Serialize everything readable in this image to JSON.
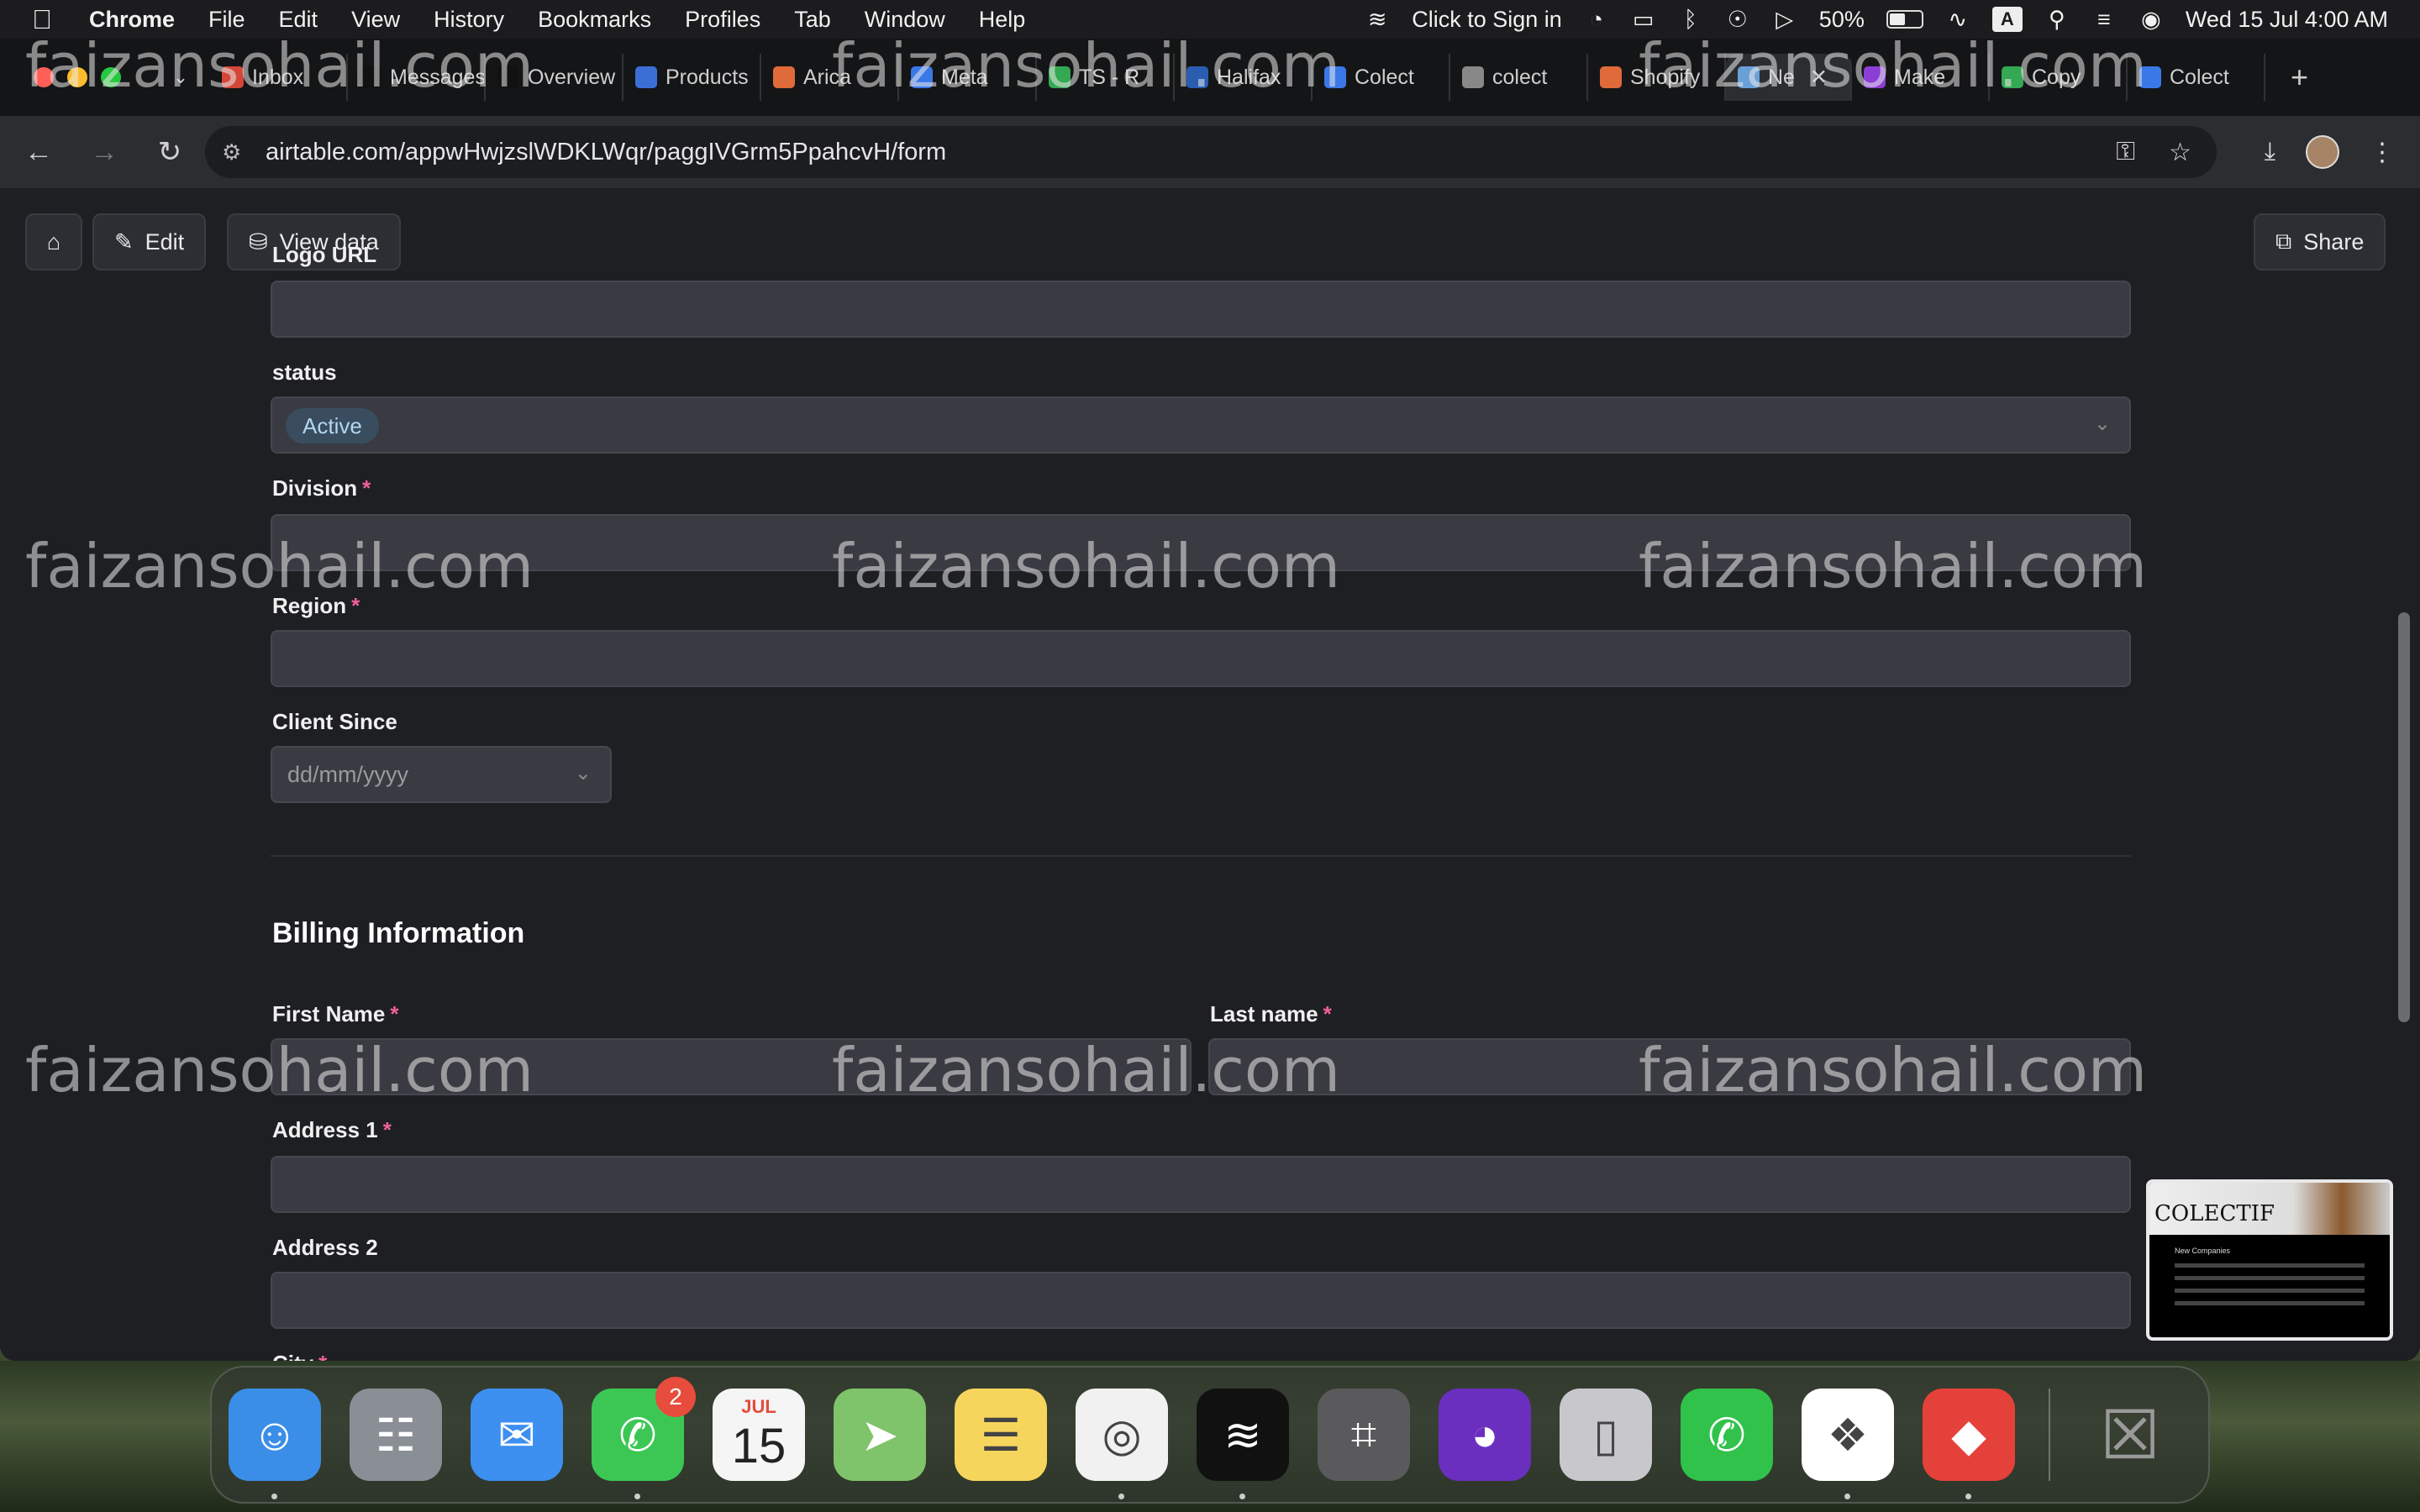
{
  "menubar": {
    "apple": "",
    "items": [
      "Chrome",
      "File",
      "Edit",
      "View",
      "History",
      "Bookmarks",
      "Profiles",
      "Tab",
      "Window",
      "Help"
    ],
    "sign_in": "Click to Sign in",
    "battery": "50%",
    "battery_level": 0.5,
    "input_source": "A",
    "datetime": "Wed 15 Jul  4:00 AM"
  },
  "tabs": [
    {
      "label": "Inbox",
      "color": "#d44638"
    },
    {
      "label": "Messages",
      "color": "#111111"
    },
    {
      "label": "Overview",
      "color": "#111111"
    },
    {
      "label": "Products",
      "color": "#3b6fd6"
    },
    {
      "label": "Arica",
      "color": "#e06a3a"
    },
    {
      "label": "Meta",
      "color": "#3b78e7"
    },
    {
      "label": "TS - R",
      "color": "#34a853"
    },
    {
      "label": "Halifax",
      "color": "#2a5db0"
    },
    {
      "label": "Colect",
      "color": "#3b78e7"
    },
    {
      "label": "colect",
      "color": "#888888"
    },
    {
      "label": "Shopify",
      "color": "#e06a3a"
    },
    {
      "label": "Ne",
      "color": "#6aa0d8",
      "active": true
    },
    {
      "label": "Make",
      "color": "#8b3dd6"
    },
    {
      "label": "Copy",
      "color": "#34a853"
    },
    {
      "label": "Colect",
      "color": "#3b78e7"
    }
  ],
  "address": {
    "url": "airtable.com/appwHwjzslWDKLWqr/paggIVGrm5PpahcvH/form"
  },
  "toolbar": {
    "home_label": "",
    "edit_label": "Edit",
    "view_data_label": "View data",
    "share_label": "Share"
  },
  "form": {
    "logo_url_label": "Logo URL",
    "status_label": "status",
    "status_value": "Active",
    "division_label": "Division",
    "region_label": "Region",
    "client_since_label": "Client Since",
    "client_since_placeholder": "dd/mm/yyyy",
    "billing_heading": "Billing Information",
    "first_name_label": "First Name",
    "last_name_label": "Last name",
    "address1_label": "Address 1",
    "address2_label": "Address 2",
    "city_label": "City",
    "required_mark": "*"
  },
  "watermark": "faizansohail.com",
  "pip": {
    "title": "COLECTIF",
    "subtitle": "New Companies"
  },
  "dock": {
    "apps": [
      {
        "name": "Finder",
        "bg": "#3b8ee8"
      },
      {
        "name": "Launchpad",
        "bg": "#8a8f96"
      },
      {
        "name": "Mail",
        "bg": "#3d8ff0"
      },
      {
        "name": "Messages",
        "bg": "#3cc754",
        "badge": "2"
      },
      {
        "name": "Calendar",
        "bg": "#f5f5f5",
        "month": "JUL",
        "day": "15"
      },
      {
        "name": "Maps",
        "bg": "#7fc36a"
      },
      {
        "name": "Notes",
        "bg": "#f6d55c"
      },
      {
        "name": "Chrome",
        "bg": "#f1f1f1"
      },
      {
        "name": "Spotify",
        "bg": "#111111"
      },
      {
        "name": "Calculator",
        "bg": "#5a5a5c"
      },
      {
        "name": "Firefox",
        "bg": "#6b2fc0"
      },
      {
        "name": "iPhone Mirroring",
        "bg": "#c8c8cc"
      },
      {
        "name": "WhatsApp",
        "bg": "#30c24b"
      },
      {
        "name": "Slack",
        "bg": "#ffffff"
      },
      {
        "name": "AnyDesk",
        "bg": "#e5413b"
      },
      {
        "name": "Trash",
        "bg": "transparent"
      }
    ]
  }
}
